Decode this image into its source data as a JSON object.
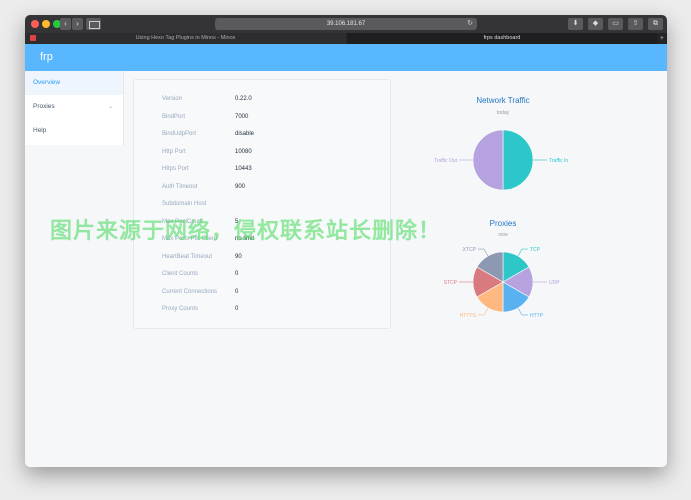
{
  "browser": {
    "url": "39.106.181.67",
    "tabs": [
      {
        "label": "Using Hexo Tag Plugins in Minos - Minos"
      },
      {
        "label": "frps dashboard"
      }
    ],
    "new_tab": "+"
  },
  "app": {
    "brand": "frp",
    "menu": [
      {
        "label": "Overview",
        "active": true
      },
      {
        "label": "Proxies",
        "chevron": "⌄"
      },
      {
        "label": "Help"
      }
    ]
  },
  "overview": {
    "rows": [
      {
        "key": "Version",
        "value": "0.22.0"
      },
      {
        "key": "BindPort",
        "value": "7000"
      },
      {
        "key": "BindUdpPort",
        "value": "disable"
      },
      {
        "key": "Http Port",
        "value": "10080"
      },
      {
        "key": "Https Port",
        "value": "10443"
      },
      {
        "key": "Auth Timeout",
        "value": "900"
      },
      {
        "key": "Subdomain Host",
        "value": ""
      },
      {
        "key": "Max PoolCount",
        "value": "5"
      },
      {
        "key": "Max Ports Per Client",
        "value": "no limit"
      },
      {
        "key": "HeartBeat Timeout",
        "value": "90"
      },
      {
        "key": "Client Counts",
        "value": "0"
      },
      {
        "key": "Current Connections",
        "value": "0"
      },
      {
        "key": "Proxy Counts",
        "value": "0"
      }
    ]
  },
  "watermark": "图片来源于网络，侵权联系站长删除！",
  "chart_data": [
    {
      "type": "pie",
      "title": "Network Traffic",
      "subtitle": "today",
      "categories": [
        "Traffic In",
        "Traffic Out"
      ],
      "values": [
        50,
        50
      ],
      "colors": [
        "#2ec7c9",
        "#b6a2de"
      ]
    },
    {
      "type": "pie",
      "title": "Proxies",
      "subtitle": "now",
      "categories": [
        "TCP",
        "UDP",
        "HTTP",
        "HTTPS",
        "STCP",
        "XTCP"
      ],
      "values": [
        1,
        1,
        1,
        1,
        1,
        1
      ],
      "colors": [
        "#2ec7c9",
        "#b6a2de",
        "#5ab1ef",
        "#ffb980",
        "#d87a80",
        "#8d98b3"
      ]
    }
  ]
}
